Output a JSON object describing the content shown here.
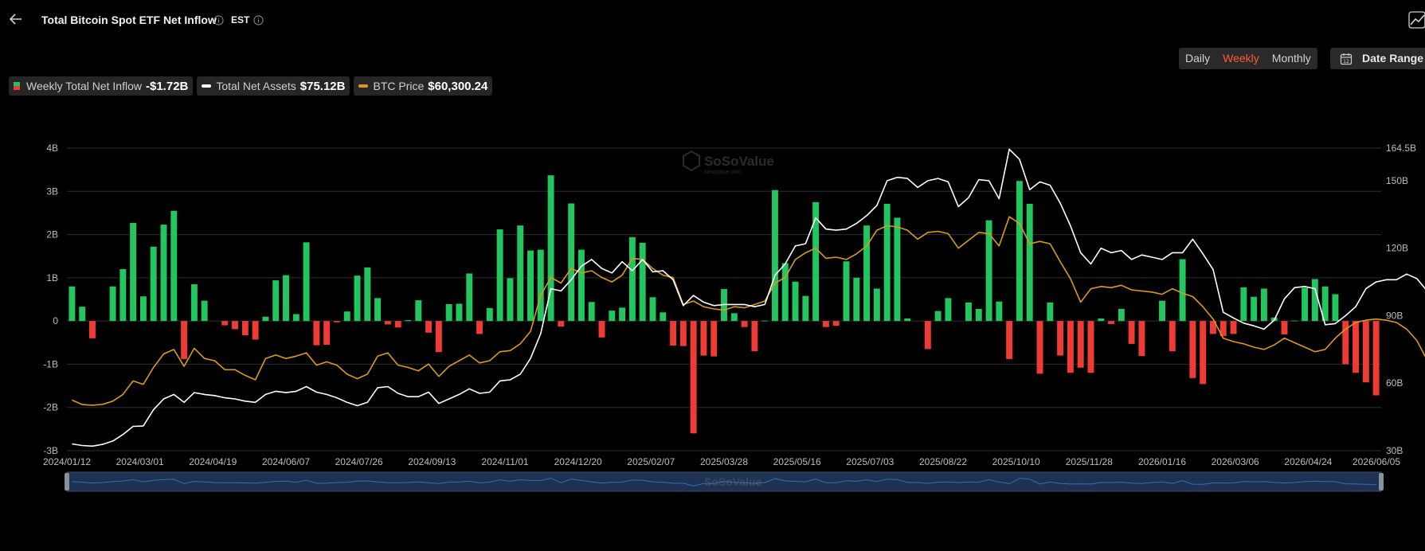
{
  "header": {
    "title": "Total Bitcoin Spot ETF Net Inflow",
    "timezone": "EST"
  },
  "controls": {
    "periods": [
      "Daily",
      "Weekly",
      "Monthly"
    ],
    "active_period": "Weekly",
    "date_range_label": "Date Range"
  },
  "legend": [
    {
      "label": "Weekly Total Net Inflow",
      "value": "-$1.72B"
    },
    {
      "label": "Total Net Assets",
      "value": "$75.12B"
    },
    {
      "label": "BTC Price",
      "value": "$60,300.24"
    }
  ],
  "watermark": {
    "brand": "SoSoValue",
    "sub": "sosovalue.com"
  },
  "colors": {
    "positive_bar": "#22c55e",
    "negative_bar": "#ef3b36",
    "net_assets_line": "#ffffff",
    "btc_price_line": "#d99a1e",
    "active_period": "#ff5a36",
    "gridline": "#2e2e2e",
    "navigator_fill": "#1e3354"
  },
  "chart_data": {
    "type": "bar",
    "left_axis": {
      "ylim": [
        -3,
        4
      ],
      "ticks": [
        "4B",
        "3B",
        "2B",
        "1B",
        "0",
        "-1B",
        "-2B",
        "-3B"
      ],
      "unit": "B"
    },
    "right_axis": {
      "ylim": [
        30,
        164.5
      ],
      "ticks": [
        "164.5B",
        "150B",
        "120B",
        "90B",
        "60B",
        "30B"
      ],
      "unit": "B"
    },
    "x_tick_labels": [
      "2024/01/12",
      "2024/03/01",
      "2024/04/19",
      "2024/06/07",
      "2024/07/26",
      "2024/09/13",
      "2024/11/01",
      "2024/12/20",
      "2025/02/07",
      "2025/03/28",
      "2025/05/16",
      "2025/07/03",
      "2025/08/22",
      "2025/10/10",
      "2025/11/28",
      "2026/01/16",
      "2026/03/06",
      "2026/04/24",
      "2026/06/05"
    ],
    "first_week": "2024/01/12",
    "last_week": "2026/06/05",
    "week_count": 126,
    "grid": true,
    "series": [
      {
        "name": "Weekly Total Net Inflow",
        "axis": "left",
        "type": "bar",
        "values": [
          0.8,
          0.33,
          -0.4,
          0,
          0.8,
          1.2,
          2.27,
          0.57,
          1.72,
          2.23,
          2.55,
          -0.88,
          0.85,
          0.47,
          0,
          -0.1,
          -0.19,
          -0.33,
          -0.43,
          0.1,
          0.94,
          1.06,
          0.16,
          1.82,
          -0.56,
          -0.55,
          -0.03,
          0.22,
          1.05,
          1.24,
          0.53,
          -0.08,
          -0.15,
          0.02,
          0.48,
          -0.27,
          -0.72,
          0.39,
          0.4,
          1.1,
          -0.3,
          0.3,
          2.12,
          0.99,
          2.21,
          1.63,
          1.65,
          3.37,
          -0.13,
          2.72,
          1.65,
          0.44,
          -0.38,
          0.24,
          0.31,
          1.94,
          1.81,
          0.55,
          0.2,
          -0.57,
          -0.58,
          -2.6,
          -0.8,
          -0.82,
          0.74,
          0.18,
          -0.14,
          -0.7,
          0.01,
          3.03,
          1.34,
          0.91,
          0.58,
          2.75,
          -0.14,
          -0.11,
          1.38,
          1.0,
          2.21,
          0.75,
          2.71,
          2.39,
          0.06,
          0,
          -0.65,
          0.23,
          0.53,
          0,
          0.43,
          0.28,
          2.33,
          0.45,
          -0.88,
          3.24,
          2.71,
          -1.22,
          0.43,
          -0.8,
          -1.2,
          -1.08,
          -1.2,
          0.06,
          -0.07,
          0.28,
          -0.53,
          -0.81,
          0,
          0.47,
          -0.7,
          1.43,
          -1.32,
          -1.46,
          -0.3,
          -0.35,
          -0.3,
          0.78,
          0.56,
          0.75,
          0.08,
          -0.31,
          0.01,
          0.77,
          0.97,
          0.8,
          0.62,
          -1.0,
          -1.2,
          -1.42,
          -1.72
        ]
      },
      {
        "name": "Total Net Assets",
        "axis": "right",
        "type": "line",
        "values": [
          33.0,
          32.3,
          32.0,
          32.8,
          34.3,
          37.2,
          40.8,
          41.0,
          48.2,
          53.0,
          55.0,
          51.5,
          55.8,
          55.0,
          54.5,
          53.5,
          53.0,
          52.0,
          51.5,
          55.0,
          56.4,
          55.8,
          56.4,
          58.5,
          56.0,
          55.0,
          53.5,
          51.5,
          50.0,
          51.5,
          58.0,
          58.5,
          55.5,
          54.0,
          54.0,
          56.0,
          51.0,
          53.0,
          55.0,
          57.5,
          55.5,
          56.0,
          61.0,
          61.5,
          64.0,
          71.0,
          82.0,
          102.0,
          101.0,
          106.0,
          112.0,
          115.0,
          111.0,
          109.0,
          114.0,
          110.0,
          115.0,
          109.5,
          110.0,
          106.0,
          94.5,
          99.0,
          96.0,
          94.5,
          95.0,
          95.0,
          95.0,
          94.0,
          95.0,
          108.0,
          113.0,
          121.0,
          122.0,
          133.5,
          128.5,
          128.0,
          128.5,
          131.0,
          134.5,
          139.0,
          150.0,
          151.5,
          151.0,
          147.0,
          150.0,
          151.0,
          149.5,
          138.5,
          142.5,
          150.5,
          150.0,
          142.0,
          164.0,
          159.5,
          146.0,
          149.5,
          148.0,
          140.0,
          130.0,
          118.0,
          113.0,
          120.0,
          118.0,
          119.0,
          115.0,
          117.0,
          116.0,
          115.0,
          118.0,
          118.0,
          124.0,
          117.5,
          110.5,
          91.5,
          89.0,
          86.7,
          85.5,
          84.0,
          88.0,
          97.5,
          102.5,
          103.0,
          102.0,
          86.0,
          86.5,
          90.0,
          94.0,
          102.0,
          105.0,
          106.0,
          106.0,
          108.5,
          106.5,
          101.0,
          97.0,
          75.12
        ]
      },
      {
        "name": "BTC Price",
        "axis": "right",
        "type": "line",
        "values": [
          42500,
          40500,
          40200,
          40600,
          42000,
          45000,
          51000,
          49500,
          57000,
          63000,
          65000,
          57500,
          65500,
          61000,
          60000,
          56000,
          56000,
          53500,
          51500,
          61000,
          62500,
          61000,
          62000,
          63500,
          58000,
          59500,
          58000,
          54000,
          52000,
          54000,
          62000,
          63500,
          58000,
          57000,
          55500,
          58500,
          53000,
          57500,
          60000,
          62500,
          59000,
          60000,
          64000,
          64500,
          67500,
          73000,
          89000,
          97000,
          94500,
          101000,
          99000,
          100000,
          97000,
          95000,
          98000,
          105500,
          105000,
          101000,
          98000,
          97000,
          85000,
          86500,
          84000,
          83000,
          82500,
          84000,
          83500,
          85000,
          86500,
          94500,
          97000,
          105000,
          108000,
          110000,
          105500,
          106000,
          105000,
          107500,
          111000,
          118000,
          120000,
          119500,
          118000,
          114000,
          117000,
          117500,
          116500,
          110000,
          113500,
          117000,
          116500,
          111000,
          124000,
          121000,
          112000,
          113000,
          112000,
          104000,
          96500,
          86000,
          92000,
          93000,
          92500,
          93500,
          91500,
          91000,
          90500,
          89500,
          92000,
          90000,
          88500,
          84000,
          78500,
          70000,
          68500,
          67500,
          66000,
          65000,
          67000,
          70000,
          68000,
          66000,
          64000,
          65000,
          70000,
          74000,
          77000,
          78000,
          78500,
          78000,
          77000,
          74000,
          69000,
          60300.24
        ]
      }
    ]
  }
}
